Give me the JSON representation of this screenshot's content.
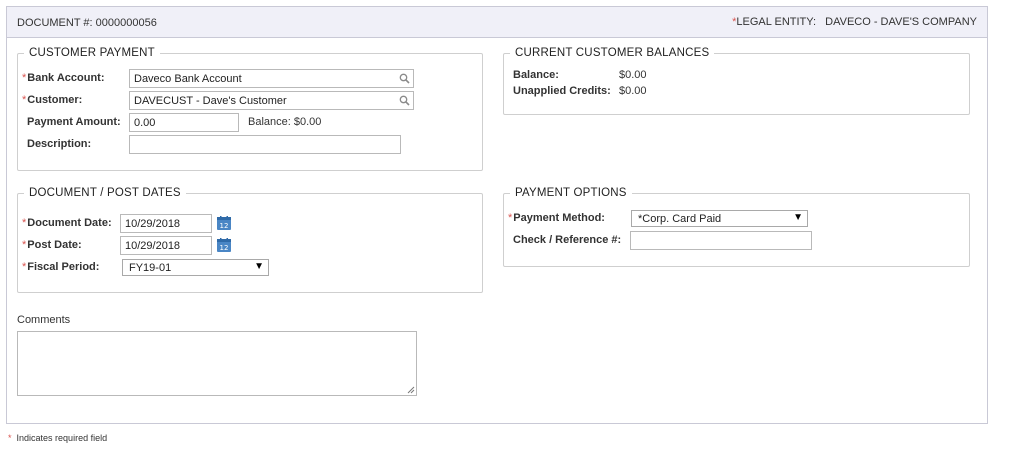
{
  "header": {
    "document_label": "DOCUMENT #:",
    "document_number": "0000000056",
    "legal_entity_label": "LEGAL ENTITY:",
    "legal_entity_value": "DAVECO - DAVE'S COMPANY",
    "required_mark": "*"
  },
  "customer_payment": {
    "legend": "CUSTOMER PAYMENT",
    "bank_account_label": "Bank Account:",
    "bank_account_value": "Daveco Bank Account",
    "customer_label": "Customer:",
    "customer_value": "DAVECUST - Dave's Customer",
    "payment_amount_label": "Payment Amount:",
    "payment_amount_value": "0.00",
    "balance_label": "Balance:",
    "balance_value": "$0.00",
    "description_label": "Description:",
    "description_value": ""
  },
  "current_balances": {
    "legend": "CURRENT CUSTOMER BALANCES",
    "balance_label": "Balance:",
    "balance_value": "$0.00",
    "unapplied_label": "Unapplied Credits:",
    "unapplied_value": "$0.00"
  },
  "dates": {
    "legend": "DOCUMENT / POST DATES",
    "document_date_label": "Document Date:",
    "document_date_value": "10/29/2018",
    "post_date_label": "Post Date:",
    "post_date_value": "10/29/2018",
    "fiscal_period_label": "Fiscal Period:",
    "fiscal_period_value": "FY19-01"
  },
  "payment_options": {
    "legend": "PAYMENT OPTIONS",
    "method_label": "Payment Method:",
    "method_value": "*Corp. Card Paid",
    "check_ref_label": "Check / Reference #:",
    "check_ref_value": ""
  },
  "comments": {
    "label": "Comments",
    "value": ""
  },
  "footer": {
    "required_note": "Indicates required field"
  },
  "colors": {
    "required": "#d9534f",
    "header_bg": "#f0f0f8",
    "calendar_icon": "#4a86c5"
  }
}
